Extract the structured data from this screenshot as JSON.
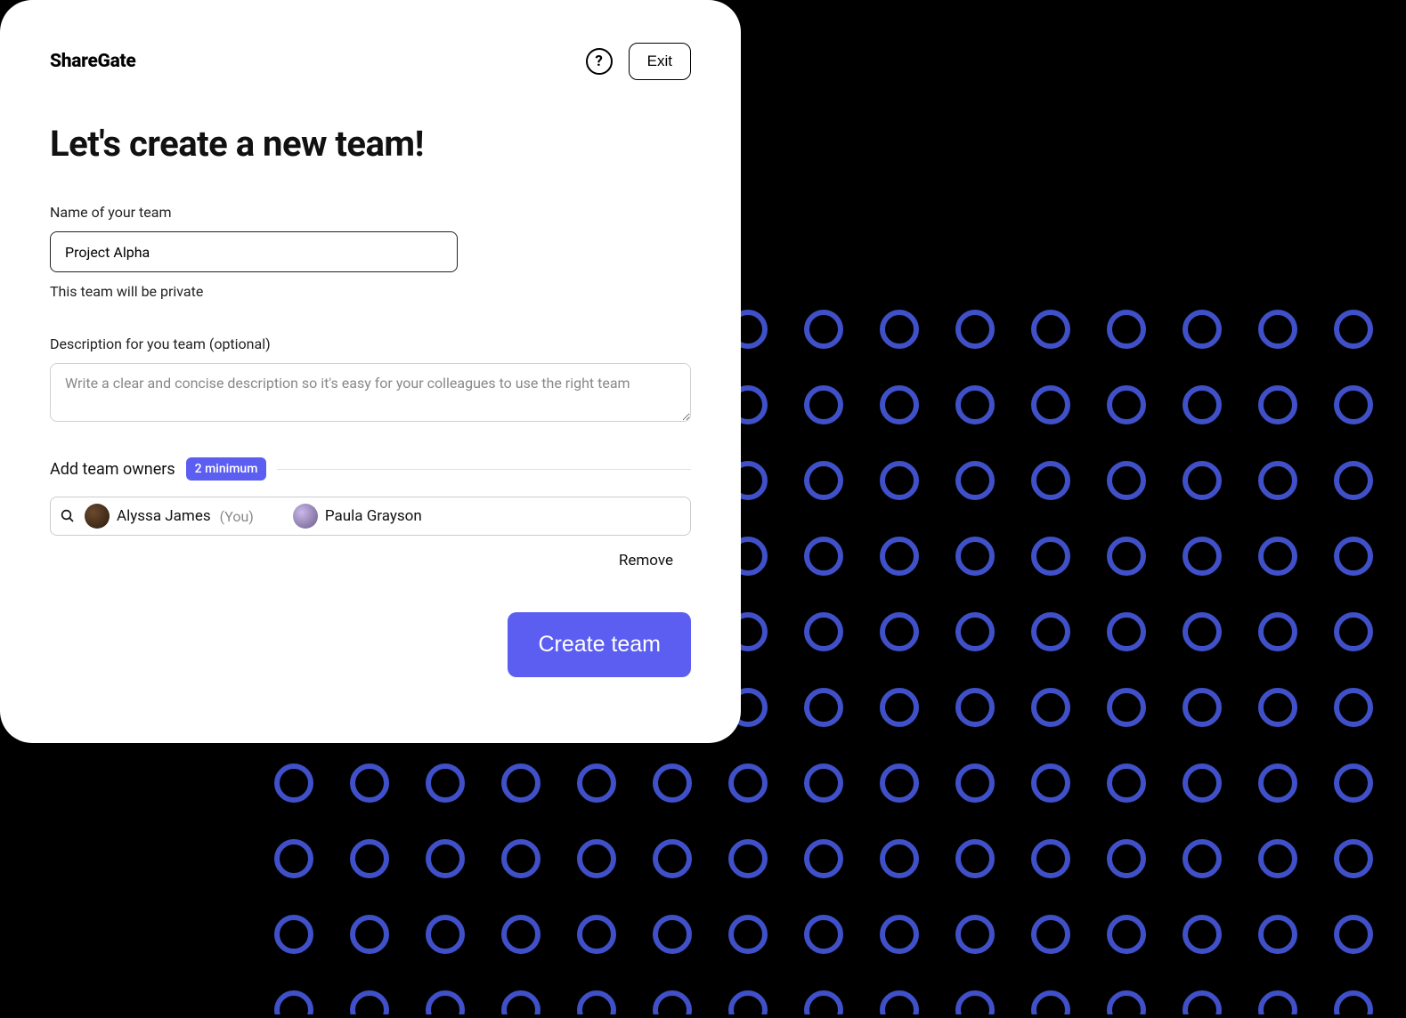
{
  "brand": "ShareGate",
  "header": {
    "help_label": "?",
    "exit_label": "Exit"
  },
  "title": "Let's create a new team!",
  "team_name": {
    "label": "Name of your team",
    "value": "Project Alpha",
    "helper": "This team will be private"
  },
  "description": {
    "label": "Description for you team (optional)",
    "placeholder": "Write a clear and concise description so it's easy for your colleagues to use the right team",
    "value": ""
  },
  "owners": {
    "label": "Add team owners",
    "badge": "2 minimum",
    "items": [
      {
        "name": "Alyssa James",
        "suffix": "(You)"
      },
      {
        "name": "Paula Grayson",
        "suffix": ""
      }
    ],
    "remove_label": "Remove"
  },
  "submit_label": "Create team",
  "colors": {
    "accent": "#5b5ef0",
    "dot_ring": "#4050c8"
  }
}
